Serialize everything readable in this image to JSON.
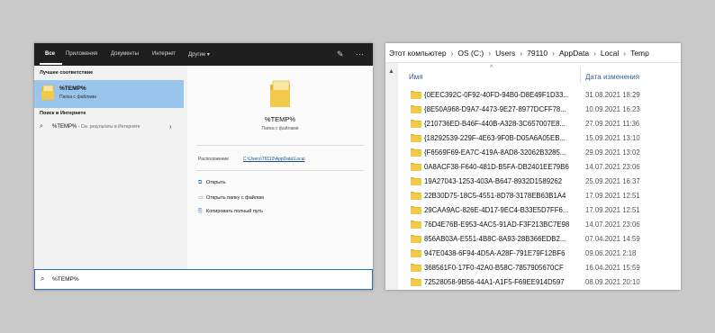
{
  "search_panel": {
    "tabs": [
      "Все",
      "Приложения",
      "Документы",
      "Интернет",
      "Другие ▾"
    ],
    "sections": {
      "best_match": "Лучшее соответствие",
      "web_search": "Поиск в Интернете"
    },
    "best_match_item": {
      "title": "%TEMP%",
      "subtitle": "Папка с файлами"
    },
    "web_item": {
      "text": "%TEMP%",
      "sub": " - См. результаты в Интернете"
    },
    "details": {
      "title": "%TEMP%",
      "subtitle": "Папка с файлами",
      "location_label": "Расположение",
      "location_value": "C:\\Users\\79110\\AppData\\Local"
    },
    "actions": [
      "Открыть",
      "Открыть папку с файлом",
      "Копировать полный путь"
    ],
    "search_input": "%TEMP%"
  },
  "explorer": {
    "breadcrumb": [
      "Этот компьютер",
      "OS (C:)",
      "Users",
      "79110",
      "AppData",
      "Local",
      "Temp"
    ],
    "columns": {
      "name": "Имя",
      "date": "Дата изменения"
    },
    "rows": [
      {
        "name": "{0EEC392C-0F92-40FD-94B0-D8E49F1D33...",
        "date": "31.08.2021 18:29"
      },
      {
        "name": "{8E50A968-D9A7-4473-9E27-8977DCFF78...",
        "date": "10.09.2021 16:23"
      },
      {
        "name": "{210736ED-B46F-440B-A328-3C657007E8...",
        "date": "27.09.2021 11:36"
      },
      {
        "name": "{18292539-229F-4E63-9F0B-D05A6A05EB...",
        "date": "15.09.2021 13:10"
      },
      {
        "name": "{F6569F69-EA7C-419A-8AD8-32062B3285...",
        "date": "29.09.2021 13:02"
      },
      {
        "name": "0A8ACF38-F640-481D-B5FA-DB2401EE79B6",
        "date": "14.07.2021 23:06"
      },
      {
        "name": "19A27043-1253-403A-B647-8932D1589262",
        "date": "25.09.2021 16:37"
      },
      {
        "name": "22B30D75-18C5-4551-8D78-3178EB63B1A4",
        "date": "17.09.2021 12:51"
      },
      {
        "name": "29CAA9AC-826E-4D17-9EC4-B33E5D7FF6...",
        "date": "17.09.2021 12:51"
      },
      {
        "name": "76D4E76B-E953-4AC5-91AD-F3F213BC7E98",
        "date": "14.07.2021 23:06"
      },
      {
        "name": "856AB03A-E551-4B8C-8A93-28B366EDB2...",
        "date": "07.04.2021 14:59"
      },
      {
        "name": "947E0438-6F94-4D5A-A28F-791E79F12BF6",
        "date": "09.06.2021 2:18"
      },
      {
        "name": "368561F0-17F0-42A0-B58C-7857905670CF",
        "date": "16.04.2021 15:59"
      },
      {
        "name": "72528058-9B56-44A1-A1F5-F69EE914D597",
        "date": "08.09.2021 20:10"
      }
    ]
  },
  "colors": {
    "accent": "#2d6fb8",
    "selection": "#99c4ec",
    "folder": "#f2c94c",
    "taskbar": "#1f1f1f"
  }
}
